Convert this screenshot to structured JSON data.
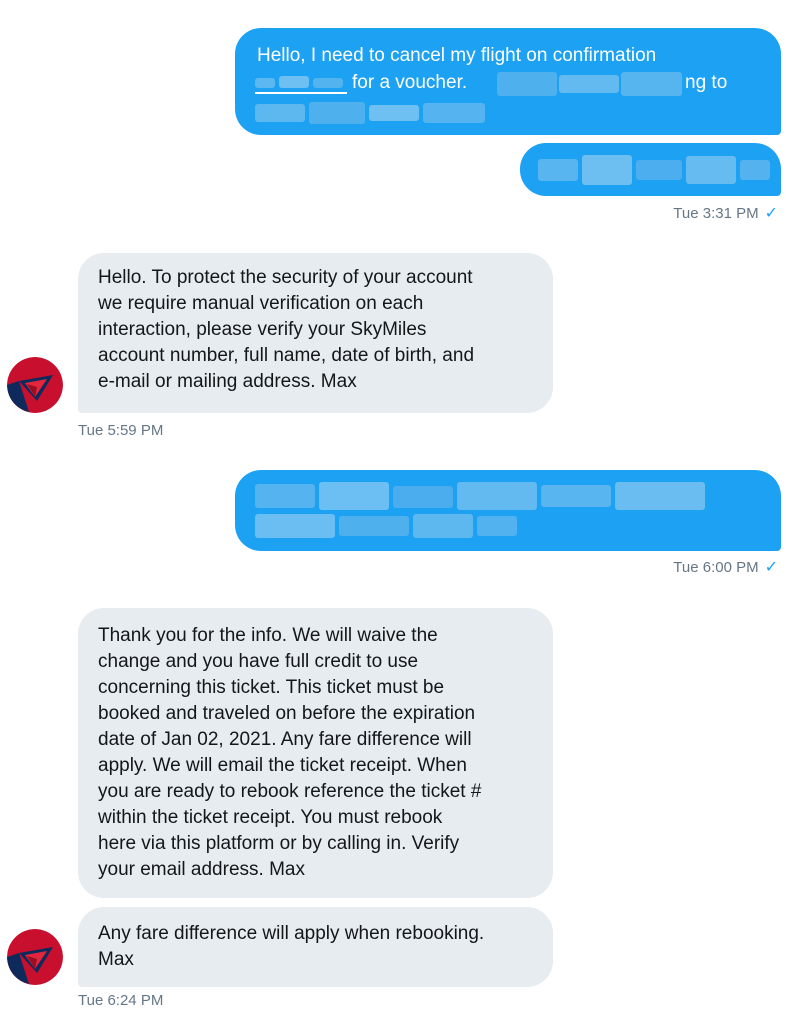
{
  "messages": [
    {
      "id": "m1",
      "direction": "outgoing",
      "lines": [
        "Hello, I need to cancel my flight on confirmation",
        "for a voucher.",
        "ng to"
      ]
    },
    {
      "id": "m3",
      "direction": "incoming",
      "lines": [
        "Hello. To protect the security of your account",
        "we require manual verification on each",
        "interaction, please verify your SkyMiles",
        "account number, full name, date of birth, and",
        "e-mail or mailing address. Max"
      ]
    },
    {
      "id": "m5",
      "direction": "incoming",
      "lines": [
        "Thank you for the info. We will waive the",
        "change and you have full credit to use",
        "concerning this ticket. This ticket must be",
        "booked and traveled on before the expiration",
        "date of Jan 02, 2021. Any fare difference will",
        "apply. We will email the ticket receipt. When",
        "you are ready to rebook reference the ticket #",
        "within the ticket receipt. You must rebook",
        "here via this platform or by calling in. Verify",
        "your email address. Max"
      ]
    },
    {
      "id": "m6",
      "direction": "incoming",
      "lines": [
        "Any fare difference will apply when rebooking.",
        "Max"
      ]
    }
  ],
  "timestamps": {
    "t1": "Tue 3:31 PM",
    "t2": "Tue 5:59 PM",
    "t3": "Tue 6:00 PM",
    "t4": "Tue 6:24 PM"
  },
  "icons": {
    "read_check": "✓",
    "avatar": "delta-logo-icon"
  },
  "colors": {
    "outgoing_bubble": "#1da1f2",
    "incoming_bubble": "#e6ecf0",
    "timestamp": "#657786",
    "avatar_red": "#c8102e",
    "avatar_navy": "#0e2a5c"
  }
}
